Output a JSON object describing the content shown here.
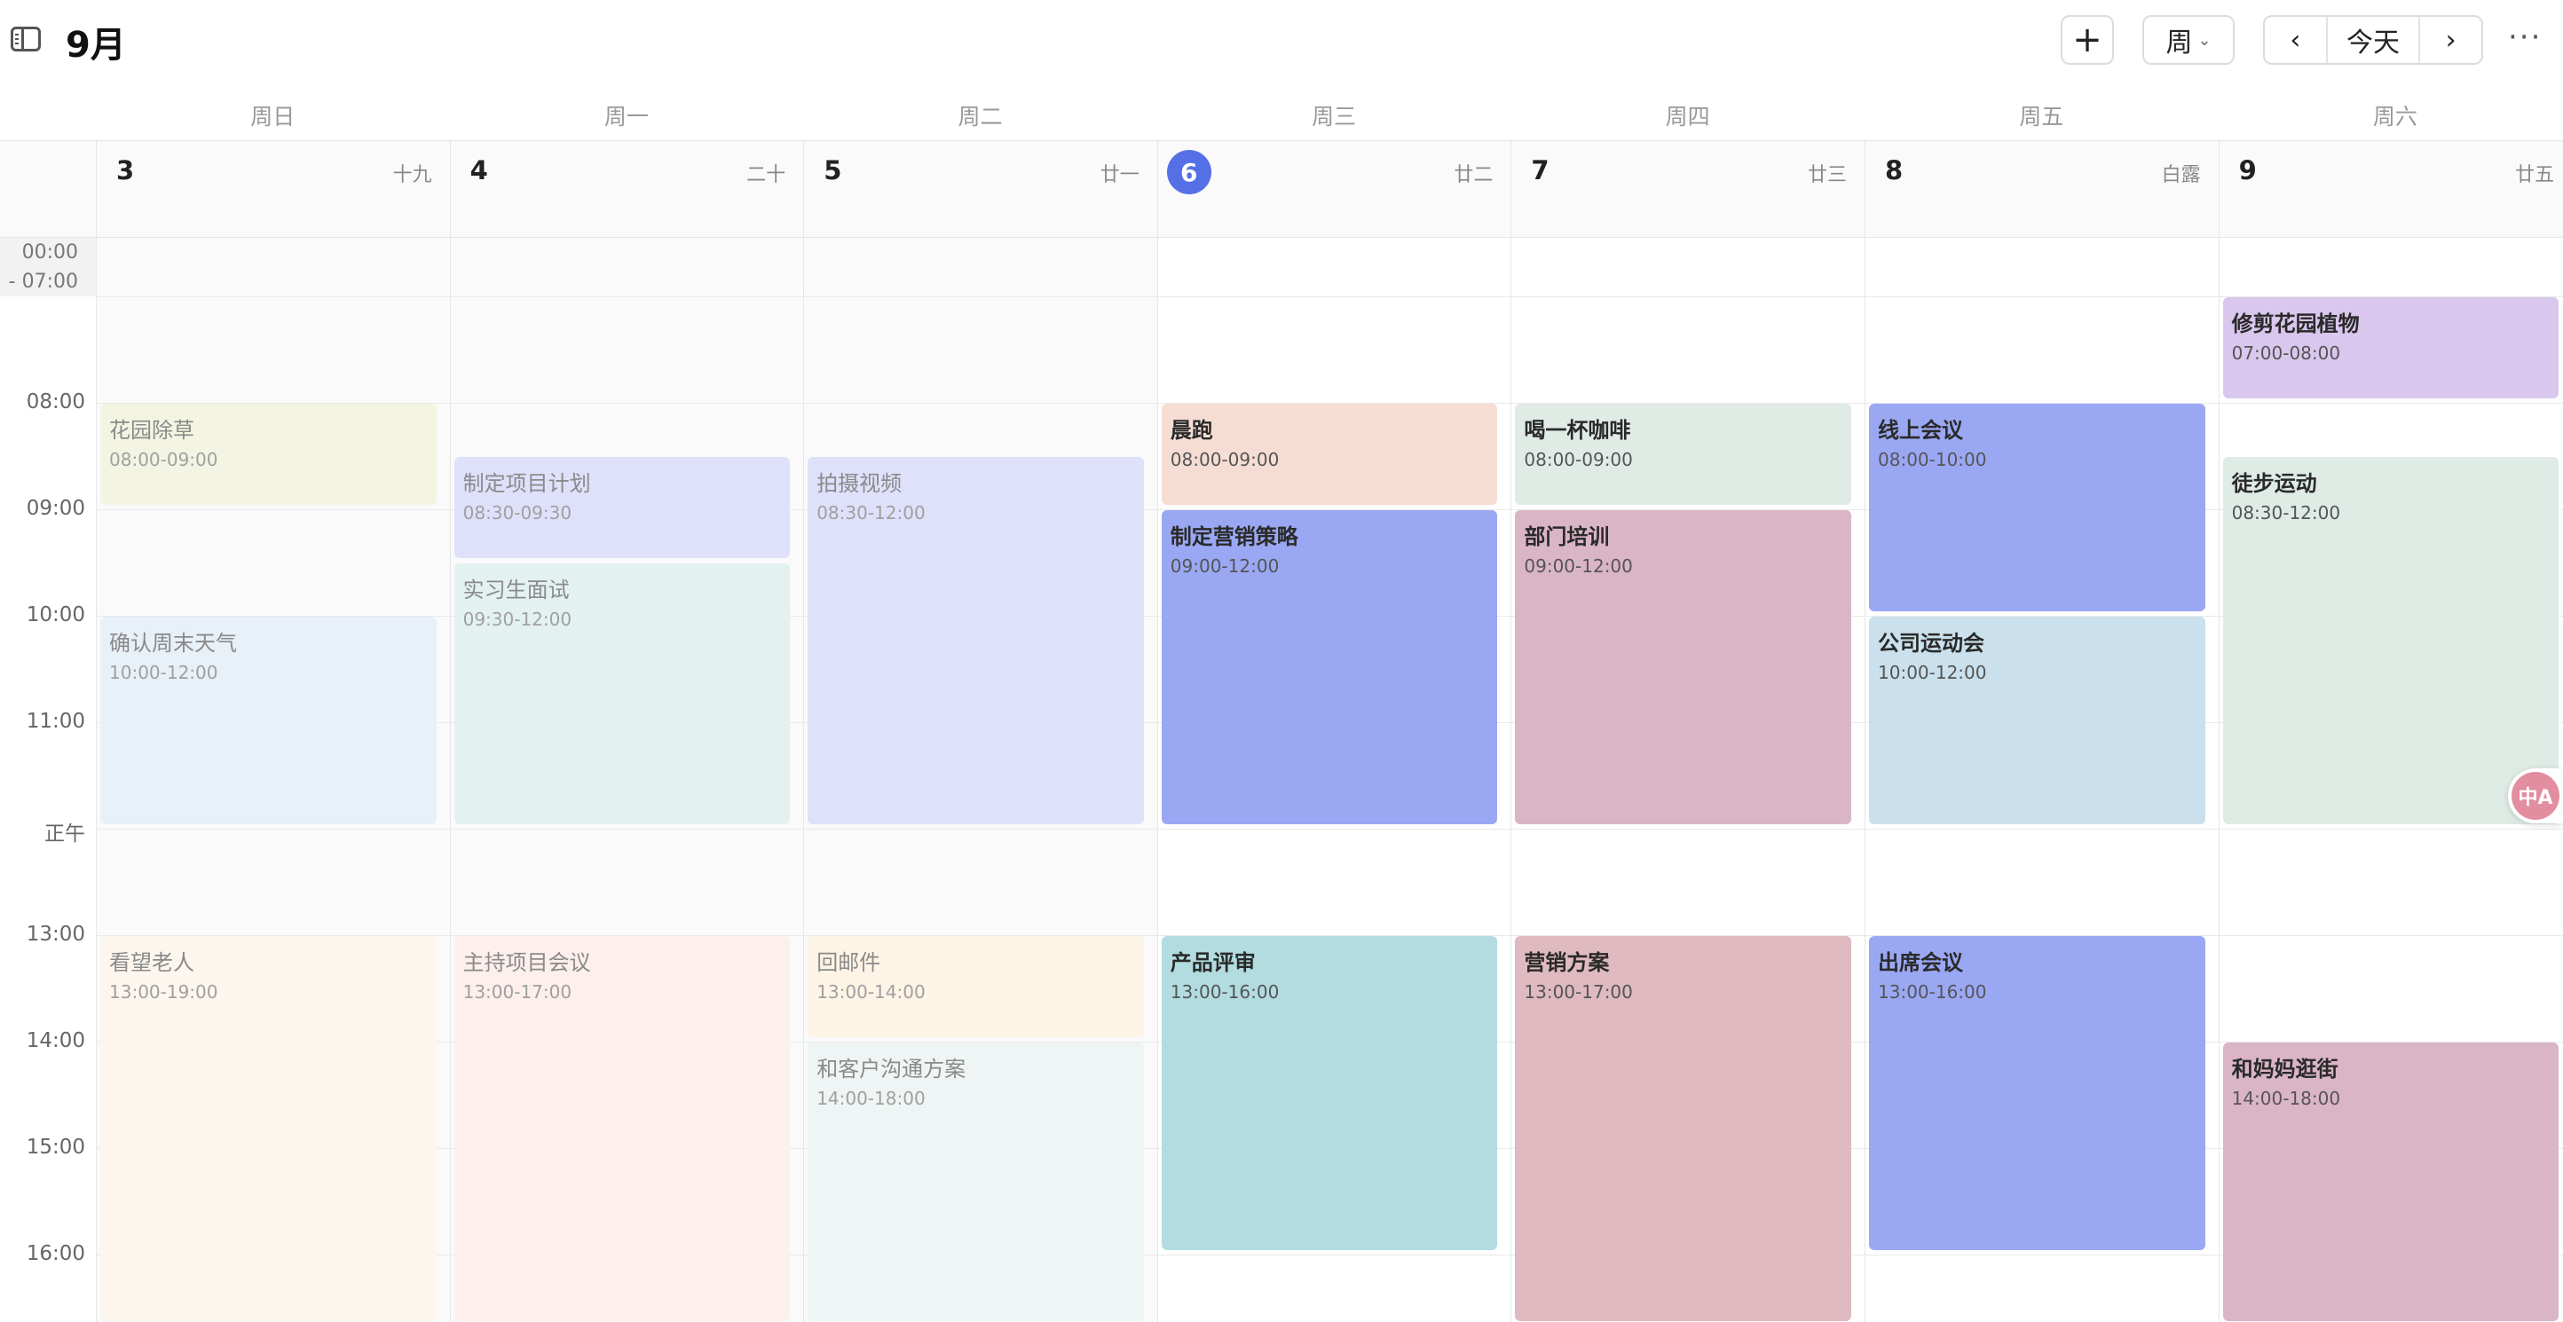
{
  "header": {
    "month_title": "9月",
    "add_label": "+",
    "view_label": "周",
    "prev_label": "‹",
    "today_label": "今天",
    "next_label": "›",
    "more_label": "···"
  },
  "weekdays": [
    "周日",
    "周一",
    "周二",
    "周三",
    "周四",
    "周五",
    "周六"
  ],
  "dates": [
    {
      "num": "3",
      "lunar": "十九"
    },
    {
      "num": "4",
      "lunar": "二十"
    },
    {
      "num": "5",
      "lunar": "廿一"
    },
    {
      "num": "6",
      "lunar": "廿二",
      "today": true
    },
    {
      "num": "7",
      "lunar": "廿三"
    },
    {
      "num": "8",
      "lunar": "白露"
    },
    {
      "num": "9",
      "lunar": "廿五"
    }
  ],
  "time_labels": {
    "collapsed_start": "00:00",
    "collapsed_end": "- 07:00",
    "hours": [
      "08:00",
      "09:00",
      "10:00",
      "11:00",
      "正午",
      "13:00",
      "14:00",
      "15:00",
      "16:00"
    ]
  },
  "events": [
    {
      "day": 0,
      "title": "花园除草",
      "time": "08:00-09:00",
      "color": "#f3f5e2",
      "past": true
    },
    {
      "day": 0,
      "title": "确认周末天气",
      "time": "10:00-12:00",
      "color": "#e8f0f8",
      "past": true
    },
    {
      "day": 0,
      "title": "看望老人",
      "time": "13:00-19:00",
      "color": "#fcf6ee",
      "past": true
    },
    {
      "day": 1,
      "title": "制定项目计划",
      "time": "08:30-09:30",
      "color": "#dfe1fb",
      "past": true
    },
    {
      "day": 1,
      "title": "实习生面试",
      "time": "09:30-12:00",
      "color": "#e3f2f1",
      "past": true
    },
    {
      "day": 1,
      "title": "主持项目会议",
      "time": "13:00-17:00",
      "color": "#fcefec",
      "past": true
    },
    {
      "day": 2,
      "title": "拍摄视频",
      "time": "08:30-12:00",
      "color": "#dfe1fb",
      "past": true
    },
    {
      "day": 2,
      "title": "回邮件",
      "time": "13:00-14:00",
      "color": "#fdf4e6",
      "past": true
    },
    {
      "day": 2,
      "title": "和客户沟通方案",
      "time": "14:00-18:00",
      "color": "#eef5f4",
      "past": true
    },
    {
      "day": 3,
      "title": "晨跑",
      "time": "08:00-09:00",
      "color": "#f5ddd3",
      "past": false
    },
    {
      "day": 3,
      "title": "制定营销策略",
      "time": "09:00-12:00",
      "color": "#9aa8f4",
      "past": false
    },
    {
      "day": 3,
      "title": "产品评审",
      "time": "13:00-16:00",
      "color": "#b2dce0",
      "past": false
    },
    {
      "day": 4,
      "title": "喝一杯咖啡",
      "time": "08:00-09:00",
      "color": "#e0ebe6",
      "past": false
    },
    {
      "day": 4,
      "title": "部门培训",
      "time": "09:00-12:00",
      "color": "#dab5c6",
      "past": false
    },
    {
      "day": 4,
      "title": "营销方案",
      "time": "13:00-17:00",
      "color": "#dfbac0",
      "past": false
    },
    {
      "day": 5,
      "title": "线上会议",
      "time": "08:00-10:00",
      "color": "#9aa8f4",
      "past": false
    },
    {
      "day": 5,
      "title": "公司运动会",
      "time": "10:00-12:00",
      "color": "#cae0ec",
      "past": false
    },
    {
      "day": 5,
      "title": "出席会议",
      "time": "13:00-16:00",
      "color": "#9aa8f4",
      "past": false
    },
    {
      "day": 6,
      "title": "修剪花园植物",
      "time": "07:00-08:00",
      "color": "#d9c7ee",
      "past": false
    },
    {
      "day": 6,
      "title": "徒步运动",
      "time": "08:30-12:00",
      "color": "#dfebe5",
      "past": false
    },
    {
      "day": 6,
      "title": "和妈妈逛街",
      "time": "14:00-18:00",
      "color": "#dab5c6",
      "past": false
    }
  ],
  "translate_fab_label": "中A"
}
